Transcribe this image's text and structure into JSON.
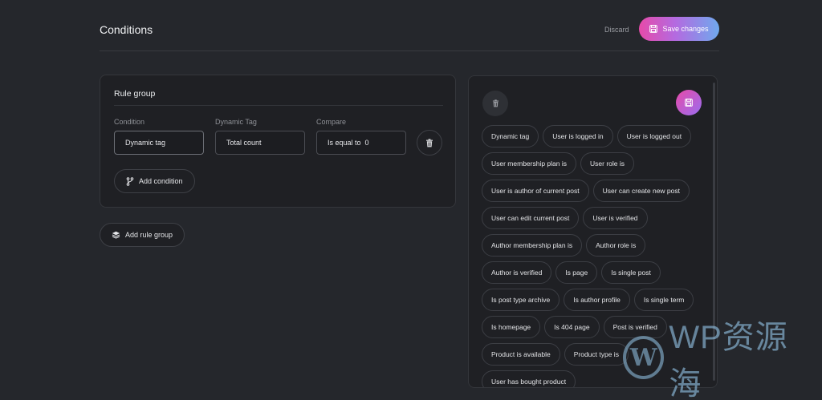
{
  "header": {
    "title": "Conditions",
    "discard_label": "Discard",
    "save_label": "Save changes"
  },
  "rule_group": {
    "title": "Rule group",
    "columns": [
      "Condition",
      "Dynamic Tag",
      "Compare"
    ],
    "condition_value": "Dynamic tag",
    "dynamic_tag_value": "Total count",
    "compare_value": "Is equal to  0",
    "add_condition_label": "Add condition"
  },
  "add_rule_group_label": "Add rule group",
  "conditions_panel": {
    "chips": [
      "Dynamic tag",
      "User is logged in",
      "User is logged out",
      "User membership plan is",
      "User role is",
      "User is author of current post",
      "User can create new post",
      "User can edit current post",
      "User is verified",
      "Author membership plan is",
      "Author role is",
      "Author is verified",
      "Is page",
      "Is single post",
      "Is post type archive",
      "Is author profile",
      "Is single term",
      "Is homepage",
      "Is 404 page",
      "Post is verified",
      "Product is available",
      "Product type is",
      "User has bought product"
    ]
  },
  "watermark": {
    "logo_letter": "W",
    "text": "WP资源海"
  },
  "colors": {
    "background": "#25272c",
    "card": "#1f2024",
    "accent_gradient_start": "#e64aa9",
    "accent_gradient_end": "#6fa9ee"
  },
  "icons": [
    "save-icon",
    "trash-icon",
    "branch-icon",
    "layers-icon"
  ]
}
